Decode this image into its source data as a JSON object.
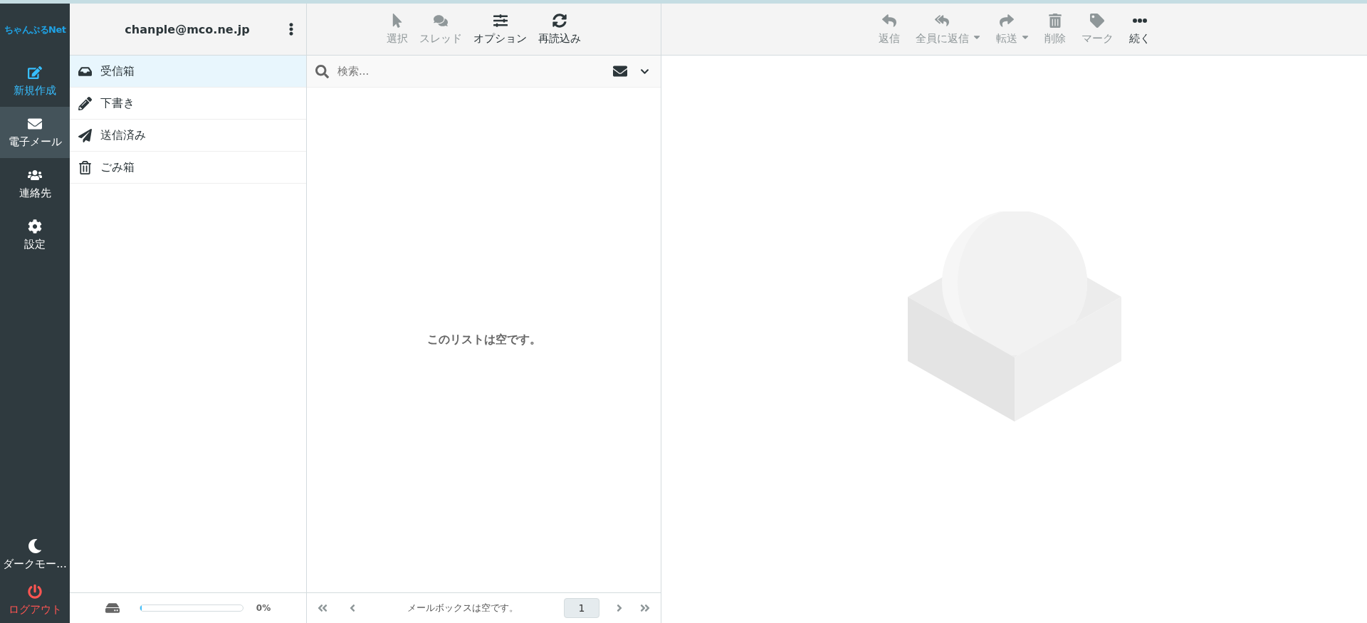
{
  "logo": "ちゃんぷるNet",
  "nav": [
    {
      "label": "新規作成",
      "kind": "compose",
      "selected": false
    },
    {
      "label": "電子メール",
      "kind": "normal",
      "selected": true
    },
    {
      "label": "連絡先",
      "kind": "normal",
      "selected": false
    },
    {
      "label": "設定",
      "kind": "normal",
      "selected": false
    }
  ],
  "nav_bottom": [
    {
      "label": "ダークモー...",
      "kind": "normal"
    },
    {
      "label": "ログアウト",
      "kind": "logout"
    }
  ],
  "account": "chanple@mco.ne.jp",
  "folders": [
    {
      "label": "受信箱",
      "selected": true
    },
    {
      "label": "下書き",
      "selected": false
    },
    {
      "label": "送信済み",
      "selected": false
    },
    {
      "label": "ごみ箱",
      "selected": false
    }
  ],
  "quota": {
    "level": 0,
    "reading": "0%"
  },
  "list_toolbar": [
    {
      "label": "選択",
      "disabled": true
    },
    {
      "label": "スレッド",
      "disabled": true
    },
    {
      "label": "オプション",
      "disabled": false
    },
    {
      "label": "再読込み",
      "disabled": false
    }
  ],
  "search": {
    "placeholder": "検索..."
  },
  "list_empty": "このリストは空です。",
  "pager": {
    "status": "メールボックスは空です。",
    "page": "1"
  },
  "message_toolbar": [
    {
      "label": "返信",
      "disabled": true,
      "dropdown": false
    },
    {
      "label": "全員に返信",
      "disabled": true,
      "dropdown": true
    },
    {
      "label": "転送",
      "disabled": true,
      "dropdown": true
    },
    {
      "label": "削除",
      "disabled": true,
      "dropdown": false
    },
    {
      "label": "マーク",
      "disabled": true,
      "dropdown": false
    },
    {
      "label": "続く",
      "disabled": false,
      "dropdown": false
    }
  ]
}
